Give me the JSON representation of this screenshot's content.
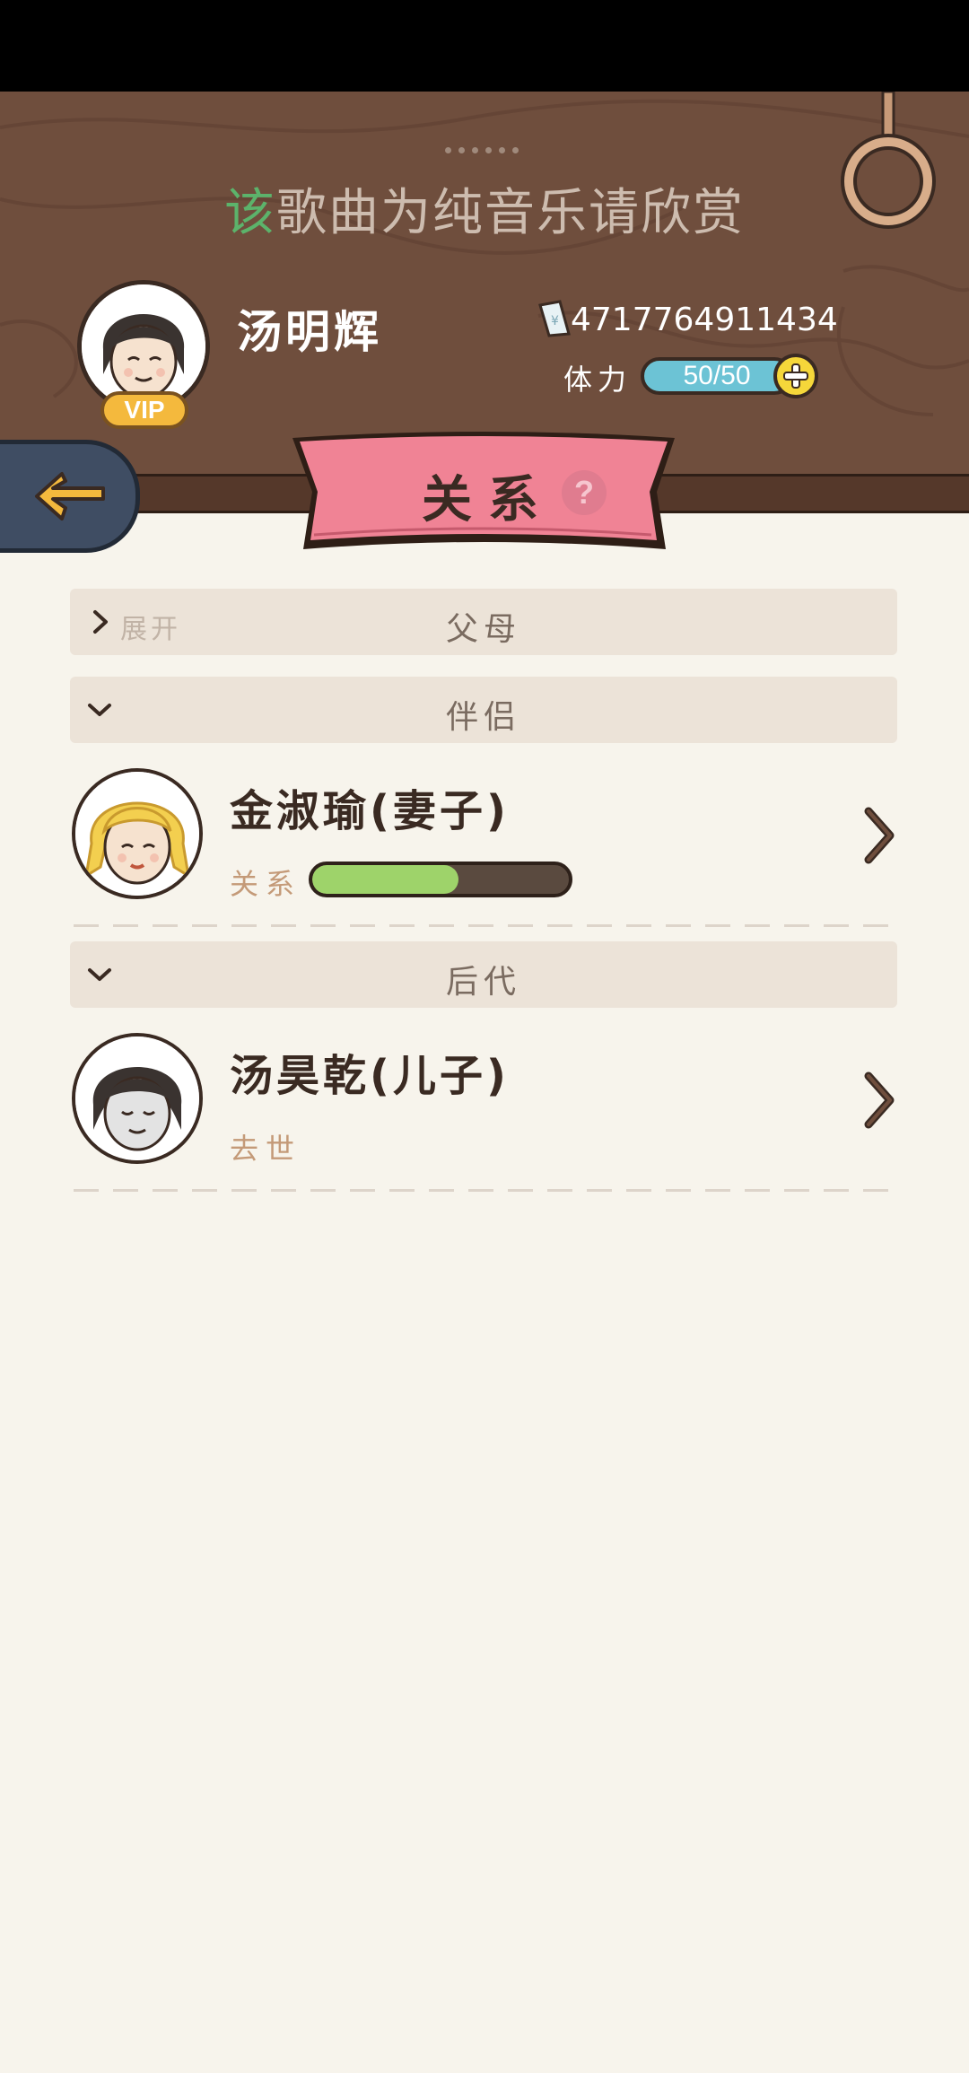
{
  "header": {
    "lyric_highlight": "该",
    "lyric_rest": "歌曲为纯音乐请欣赏",
    "player_name": "汤明辉",
    "vip_label": "VIP",
    "money": "4717764911434",
    "stamina_label": "体力",
    "stamina_value": "50/50",
    "icons": {
      "back": "back-arrow-icon",
      "money": "money-note-icon",
      "stamina_add": "plus-icon",
      "help": "question-icon",
      "ring": "hanging-ring-icon"
    }
  },
  "page": {
    "title": "关系",
    "help_symbol": "?"
  },
  "sections": {
    "parents": {
      "expand_label": "展开",
      "title": "父母"
    },
    "partner": {
      "title": "伴侣"
    },
    "descendants": {
      "title": "后代"
    }
  },
  "relations": {
    "spouse": {
      "name": "金淑瑜(妻子)",
      "relation_label": "关系",
      "relation_level": 0.57
    },
    "son": {
      "name": "汤昊乾(儿子)",
      "status": "去世"
    }
  },
  "colors": {
    "header_bg": "#6f4e3d",
    "page_bg": "#f7f4ec",
    "ribbon": "#f08395",
    "highlight_green": "#5cb36b",
    "relation_fill": "#9ed36a",
    "stamina_bar": "#6cc3d5"
  }
}
